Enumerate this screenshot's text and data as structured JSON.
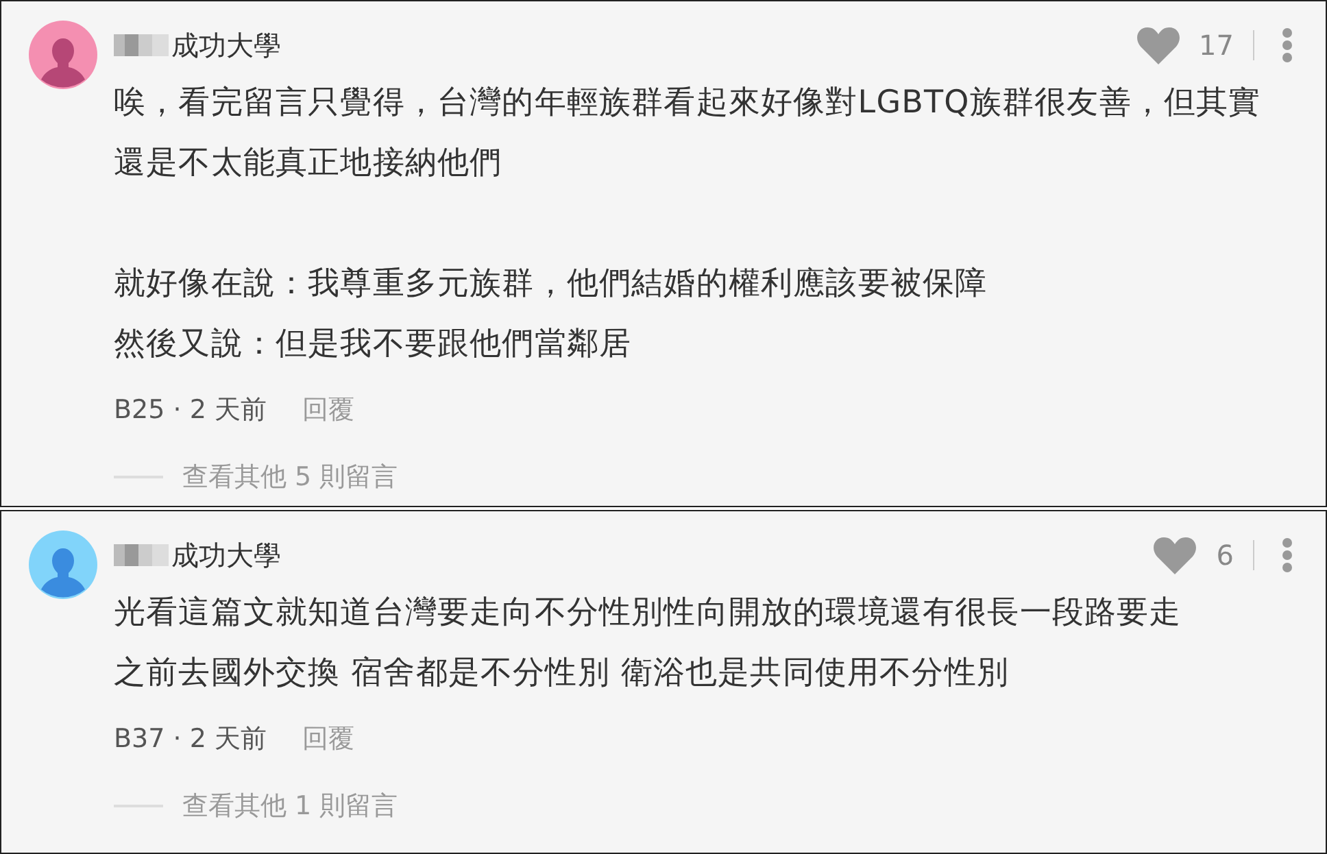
{
  "comments": [
    {
      "author": "成功大學",
      "color": "#f48fb1",
      "likes": "17",
      "paragraphs": [
        [
          "唉，看完留言只覺得，台灣的年輕族群看起來好像對LGBTQ族群很友善，但其實",
          "還是不太能真正地接納他們"
        ],
        [
          "就好像在說：我尊重多元族群，他們結婚的權利應該要被保障",
          "然後又說：但是我不要跟他們當鄰居"
        ]
      ],
      "floor_time": "B25 · 2 天前",
      "reply": "回覆",
      "more": "查看其他 5 則留言"
    },
    {
      "author": "成功大學",
      "color": "#81d4fa",
      "likes": "6",
      "paragraphs": [
        [
          "光看這篇文就知道台灣要走向不分性別性向開放的環境還有很長一段路要走",
          "之前去國外交換 宿舍都是不分性別 衛浴也是共同使用不分性別"
        ]
      ],
      "floor_time": "B37 · 2 天前",
      "reply": "回覆",
      "more": "查看其他 1 則留言"
    }
  ]
}
